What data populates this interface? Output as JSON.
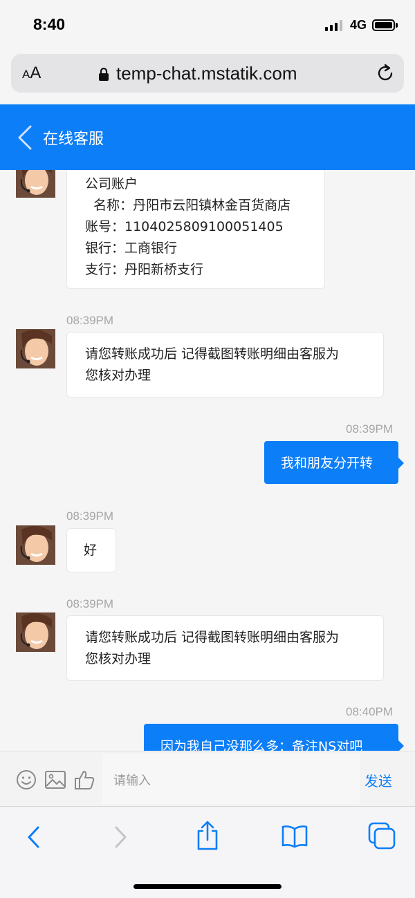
{
  "status_bar": {
    "time": "8:40",
    "network": "4G",
    "icons": [
      "signal-icon",
      "battery-icon"
    ]
  },
  "browser": {
    "text_size_label_small": "A",
    "text_size_label_large": "A",
    "url": "temp-chat.mstatik.com",
    "icons": [
      "lock-icon",
      "reload-icon"
    ]
  },
  "header": {
    "title": "在线客服",
    "back_icon": "chevron-left-icon"
  },
  "messages": [
    {
      "sender": "agent",
      "lines": [
        "公司账户",
        "  名称：丹阳市云阳镇林金百货商店",
        "账号：1104025809100051405",
        "银行：工商银行",
        "支行：丹阳新桥支行"
      ]
    },
    {
      "sender": "agent",
      "time": "08:39PM",
      "lines": [
        "请您转账成功后 记得截图转账明细由客服为",
        "您核对办理"
      ]
    },
    {
      "sender": "user",
      "time": "08:39PM",
      "lines": [
        "我和朋友分开转"
      ]
    },
    {
      "sender": "agent",
      "time": "08:39PM",
      "lines": [
        "好"
      ]
    },
    {
      "sender": "agent",
      "time": "08:39PM",
      "lines": [
        "请您转账成功后 记得截图转账明细由客服为",
        "您核对办理"
      ]
    },
    {
      "sender": "user",
      "time": "08:40PM",
      "lines": [
        "因为我自己没那么多：备注NS对吧"
      ]
    }
  ],
  "input_bar": {
    "placeholder": "请输入",
    "send_label": "发送",
    "icons": [
      "emoji-icon",
      "image-icon",
      "thumbs-up-icon"
    ]
  },
  "safari_toolbar": {
    "icons": [
      "back-icon",
      "forward-icon",
      "share-icon",
      "bookmarks-icon",
      "tabs-icon"
    ]
  },
  "colors": {
    "accent": "#0c7ef8",
    "background": "#f5f5f5",
    "bubble_in": "#ffffff",
    "timestamp": "#a6a6a6"
  }
}
